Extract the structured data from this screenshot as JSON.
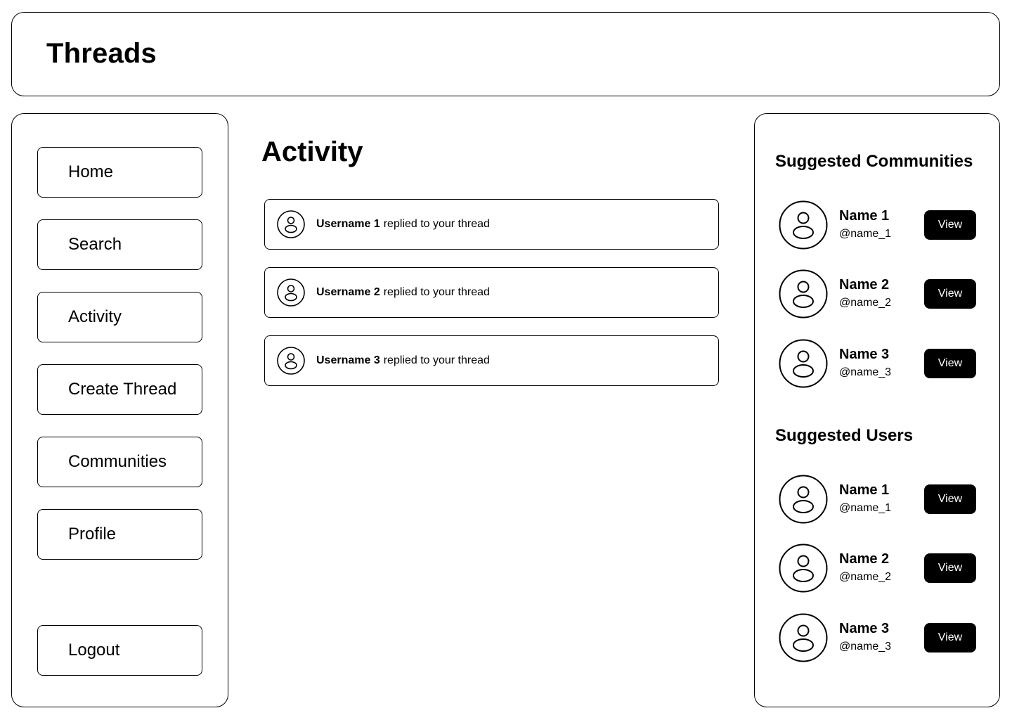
{
  "header": {
    "title": "Threads"
  },
  "sidebar": {
    "items": [
      {
        "label": "Home"
      },
      {
        "label": "Search"
      },
      {
        "label": "Activity"
      },
      {
        "label": "Create Thread"
      },
      {
        "label": "Communities"
      },
      {
        "label": "Profile"
      }
    ],
    "logout_label": "Logout"
  },
  "main": {
    "title": "Activity",
    "activities": [
      {
        "username": "Username 1",
        "text": "replied to your thread",
        "icon": "user-avatar-icon"
      },
      {
        "username": "Username 2",
        "text": "replied to your thread",
        "icon": "user-avatar-icon"
      },
      {
        "username": "Username 3",
        "text": "replied to your thread",
        "icon": "user-avatar-icon"
      }
    ]
  },
  "right_panel": {
    "communities": {
      "title": "Suggested Communities",
      "items": [
        {
          "name": "Name 1",
          "handle": "@name_1",
          "button": "View"
        },
        {
          "name": "Name 2",
          "handle": "@name_2",
          "button": "View"
        },
        {
          "name": "Name 3",
          "handle": "@name_3",
          "button": "View"
        }
      ]
    },
    "users": {
      "title": "Suggested Users",
      "items": [
        {
          "name": "Name 1",
          "handle": "@name_1",
          "button": "View"
        },
        {
          "name": "Name 2",
          "handle": "@name_2",
          "button": "View"
        },
        {
          "name": "Name 3",
          "handle": "@name_3",
          "button": "View"
        }
      ]
    }
  },
  "colors": {
    "background": "#ffffff",
    "border": "#000000",
    "button_bg": "#000000",
    "button_text": "#ffffff"
  }
}
